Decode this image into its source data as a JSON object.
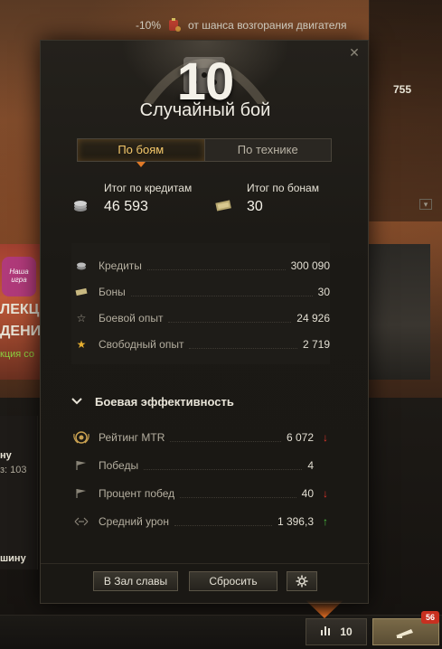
{
  "background": {
    "top_bar": {
      "percent": "-10%",
      "text": "от шанса возгорания двигателя"
    },
    "right_value": "755",
    "left_card_lines": [
      "ЛЕКЦ",
      "ДЕНИ",
      "кция со"
    ],
    "left_badge_text": "Наша игра",
    "left_list": {
      "line1": "ну",
      "line2": "з: 103",
      "line3": "шину"
    }
  },
  "dialog": {
    "level": "10",
    "title": "Случайный бой",
    "tabs": [
      {
        "label": "По боям",
        "active": true
      },
      {
        "label": "По технике",
        "active": false
      }
    ],
    "totals": {
      "credits": {
        "label": "Итог по кредитам",
        "value": "46 593",
        "icon": "coins-icon"
      },
      "bonds": {
        "label": "Итог по бонам",
        "value": "30",
        "icon": "bonds-icon"
      }
    },
    "income": [
      {
        "name": "Кредиты",
        "value": "300 090",
        "icon": "credits-icon"
      },
      {
        "name": "Боны",
        "value": "30",
        "icon": "bonds-icon"
      },
      {
        "name": "Боевой опыт",
        "value": "24 926",
        "icon": "star-outline-icon"
      },
      {
        "name": "Свободный опыт",
        "value": "2 719",
        "icon": "star-gold-icon"
      }
    ],
    "efficiency": {
      "title": "Боевая эффективность",
      "rows": [
        {
          "name": "Рейтинг MTR",
          "value": "6 072",
          "trend": "down",
          "icon": "mtr-laurel-icon"
        },
        {
          "name": "Победы",
          "value": "4",
          "trend": "",
          "icon": "flag-icon"
        },
        {
          "name": "Процент побед",
          "value": "40",
          "trend": "down",
          "icon": "flag-icon"
        },
        {
          "name": "Средний урон",
          "value": "1 396,3",
          "trend": "up",
          "icon": "damage-icon"
        }
      ]
    },
    "footer": {
      "hall_of_fame": "В Зал славы",
      "reset": "Сбросить",
      "settings_icon": "gear-icon"
    }
  },
  "bottom_bar": {
    "stats_count": "10",
    "notification_count": "56"
  }
}
